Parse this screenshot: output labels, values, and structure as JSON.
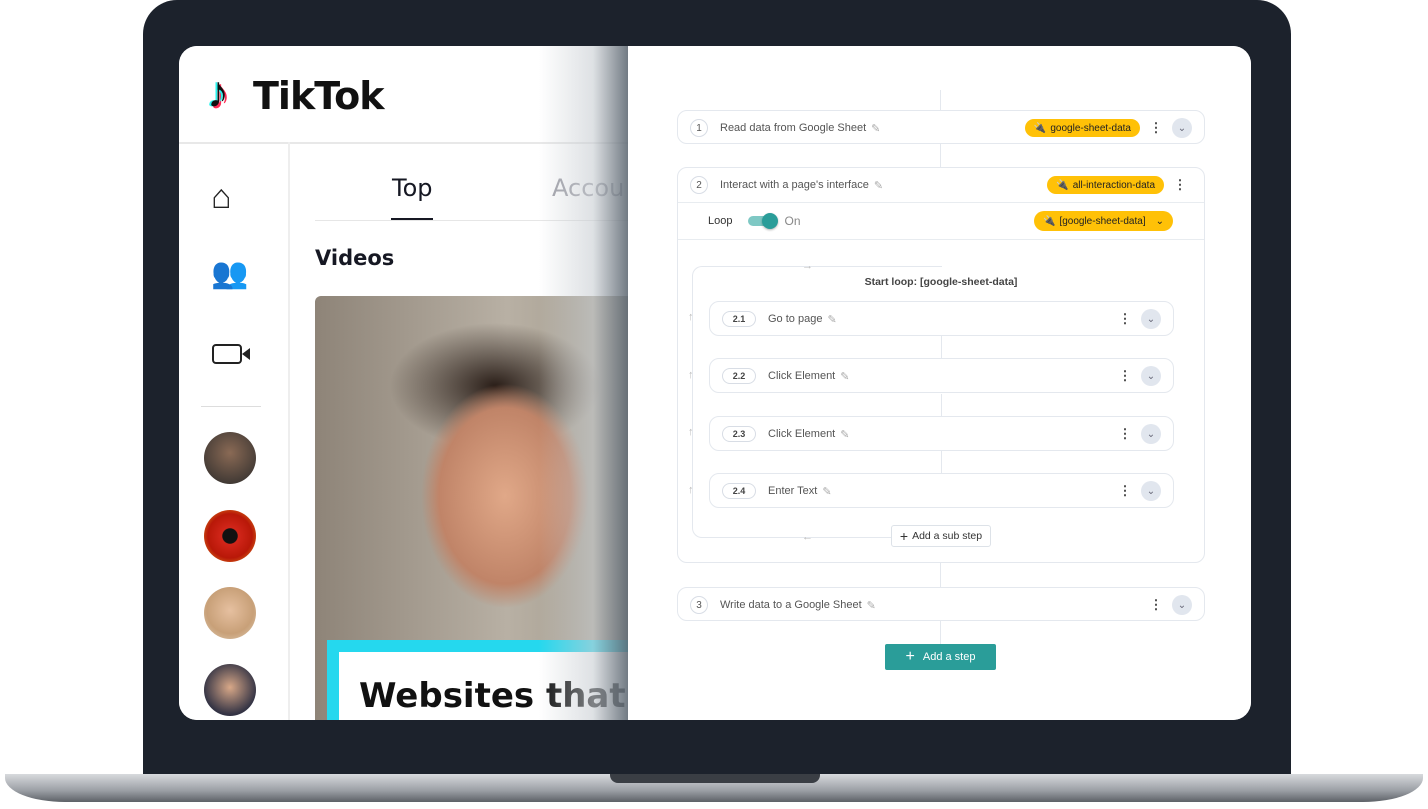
{
  "tiktok": {
    "logo": "TikTok",
    "tabs": [
      "Top",
      "Accou"
    ],
    "section": "Videos",
    "video_caption": "Websites that",
    "sidebar_icons": [
      "home-icon",
      "friends-icon",
      "live-video-icon"
    ]
  },
  "workflow": {
    "steps": [
      {
        "num": "1",
        "label": "Read data from Google Sheet",
        "badge": "google-sheet-data"
      },
      {
        "num": "2",
        "label": "Interact with a page's interface",
        "badge": "all-interaction-data",
        "loop": {
          "label": "Loop",
          "state": "On",
          "enabled": true,
          "source": "[google-sheet-data]",
          "start_label": "Start loop: [google-sheet-data]"
        },
        "substeps": [
          {
            "num": "2.1",
            "label": "Go to page"
          },
          {
            "num": "2.2",
            "label": "Click Element"
          },
          {
            "num": "2.3",
            "label": "Click Element"
          },
          {
            "num": "2.4",
            "label": "Enter Text"
          }
        ],
        "add_sub_step": "Add a sub step"
      },
      {
        "num": "3",
        "label": "Write data to a Google Sheet"
      }
    ],
    "add_step": "Add a step"
  },
  "colors": {
    "accent": "#2a9d99",
    "badge": "#ffc107",
    "frame": "#1c222c"
  }
}
